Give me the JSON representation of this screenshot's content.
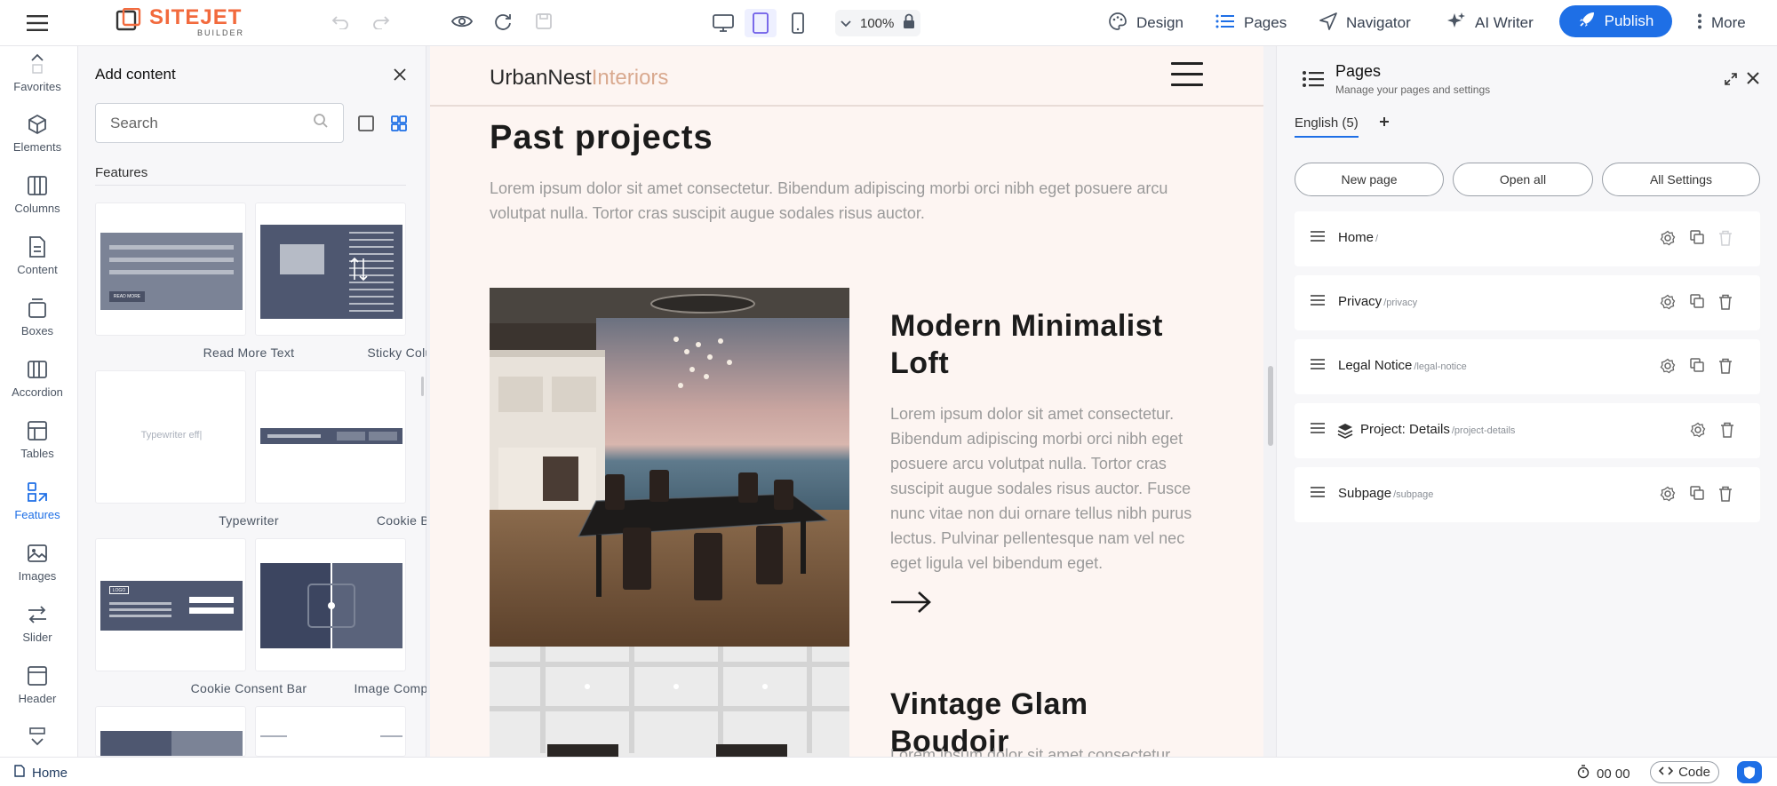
{
  "topbar": {
    "logo_main": "SITEJET",
    "logo_sub": "BUILDER",
    "zoom": "100%",
    "design_label": "Design",
    "pages_label": "Pages",
    "navigator_label": "Navigator",
    "ai_writer_label": "AI Writer",
    "publish_label": "Publish",
    "more_label": "More"
  },
  "sidebar": {
    "items": [
      {
        "label": "Favorites",
        "icon": "chevron-up-icon"
      },
      {
        "label": "Elements",
        "icon": "cube-icon"
      },
      {
        "label": "Columns",
        "icon": "columns-icon"
      },
      {
        "label": "Content",
        "icon": "document-icon"
      },
      {
        "label": "Boxes",
        "icon": "box-icon"
      },
      {
        "label": "Accordion",
        "icon": "accordion-icon"
      },
      {
        "label": "Tables",
        "icon": "table-icon"
      },
      {
        "label": "Features",
        "icon": "features-icon"
      },
      {
        "label": "Images",
        "icon": "image-icon"
      },
      {
        "label": "Slider",
        "icon": "slider-icon"
      },
      {
        "label": "Header",
        "icon": "header-icon"
      }
    ]
  },
  "add_content": {
    "title": "Add content",
    "search_placeholder": "Search",
    "section_title": "Features",
    "tiles": [
      {
        "label": "Read More Text"
      },
      {
        "label": "Sticky Column"
      },
      {
        "label": "Typewriter",
        "preview_text": "Typewriter eff|"
      },
      {
        "label": "Cookie Bar"
      },
      {
        "label": "Cookie Consent Bar",
        "preview_text": "LOGO"
      },
      {
        "label": "Image Comparison"
      }
    ],
    "read_more_preview": "READ MORE"
  },
  "canvas": {
    "brand_main": "UrbanNest",
    "brand_light": "Interiors",
    "heading": "Past projects",
    "lead": "Lorem ipsum dolor sit amet consectetur. Bibendum adipiscing morbi orci nibh eget posuere arcu volutpat nulla. Tortor cras suscipit augue sodales risus auctor.",
    "projects": [
      {
        "title": "Modern Minimalist Loft",
        "description": "Lorem ipsum dolor sit amet consectetur. Bibendum adipiscing morbi orci nibh eget posuere arcu volutpat nulla. Tortor cras suscipit augue sodales risus auctor. Fusce nunc vitae non dui ornare tellus nibh purus lectus. Pulvinar pellentesque nam vel nec eget ligula vel bibendum eget."
      },
      {
        "title": "Vintage Glam Boudoir",
        "description": "Lorem ipsum dolor sit amet consectetur."
      }
    ]
  },
  "pages_panel": {
    "title": "Pages",
    "subtitle": "Manage your pages and settings",
    "language_tab": "English (5)",
    "buttons": {
      "new_page": "New page",
      "open_all": "Open all",
      "all_settings": "All Settings"
    },
    "pages": [
      {
        "name": "Home",
        "slug": "/"
      },
      {
        "name": "Privacy",
        "slug": "/privacy"
      },
      {
        "name": "Legal Notice",
        "slug": "/legal-notice"
      },
      {
        "name": "Project: Details",
        "slug": "/project-details"
      },
      {
        "name": "Subpage",
        "slug": "/subpage"
      }
    ]
  },
  "bottombar": {
    "current_page": "Home",
    "timer": "00 00",
    "code_label": "Code"
  },
  "colors": {
    "accent": "#1e6fe6",
    "brand_orange": "#f26a3d",
    "page_bg": "#fdf5f2"
  }
}
